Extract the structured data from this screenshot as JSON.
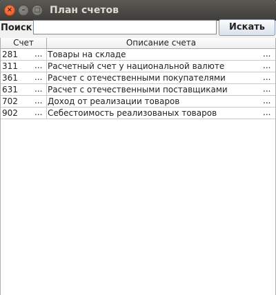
{
  "window": {
    "title": "План счетов",
    "close_glyph": "×",
    "minimize_glyph": "–",
    "maximize_glyph": "□"
  },
  "search": {
    "label": "Поиск:",
    "value": "",
    "placeholder": "",
    "button_label": "Искать"
  },
  "table": {
    "columns": [
      "Счет",
      "Описание счета"
    ],
    "ellipsis": "...",
    "rows": [
      {
        "account": "281",
        "description": "Товары на складе"
      },
      {
        "account": "311",
        "description": "Расчетный счет у национальной валюте"
      },
      {
        "account": "361",
        "description": "Расчет с отечественными покупателями"
      },
      {
        "account": "631",
        "description": "Расчет с отечественными поставщиками"
      },
      {
        "account": "702",
        "description": "Доход от реализации товаров"
      },
      {
        "account": "902",
        "description": "Себестоимость реализованых товаров"
      }
    ]
  }
}
